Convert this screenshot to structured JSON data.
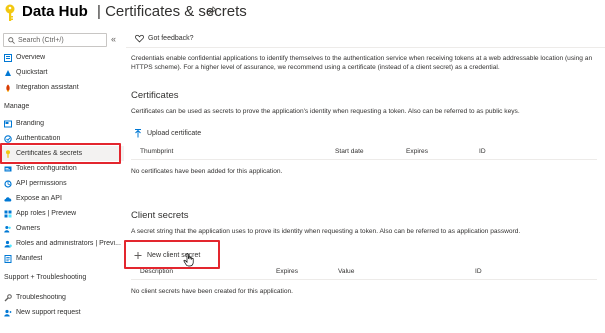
{
  "header": {
    "app_name": "Data Hub",
    "page_title": "| Certificates & secrets"
  },
  "sidebar": {
    "search_placeholder": "Search (Ctrl+/)",
    "collapse_glyph": "«",
    "items_top": [
      {
        "label": "Overview",
        "icon": "overview-icon"
      },
      {
        "label": "Quickstart",
        "icon": "quickstart-icon"
      },
      {
        "label": "Integration assistant",
        "icon": "rocket-icon"
      }
    ],
    "manage_heading": "Manage",
    "manage_items": [
      {
        "label": "Branding",
        "icon": "branding-icon"
      },
      {
        "label": "Authentication",
        "icon": "authentication-icon"
      },
      {
        "label": "Certificates & secrets",
        "icon": "key-icon",
        "active": true
      },
      {
        "label": "Token configuration",
        "icon": "token-icon"
      },
      {
        "label": "API permissions",
        "icon": "permissions-icon"
      },
      {
        "label": "Expose an API",
        "icon": "cloud-icon"
      },
      {
        "label": "App roles | Preview",
        "icon": "app-roles-icon"
      },
      {
        "label": "Owners",
        "icon": "owners-icon"
      },
      {
        "label": "Roles and administrators | Previ...",
        "icon": "roles-icon"
      },
      {
        "label": "Manifest",
        "icon": "manifest-icon"
      }
    ],
    "support_heading": "Support + Troubleshooting",
    "support_items": [
      {
        "label": "Troubleshooting",
        "icon": "wrench-icon"
      },
      {
        "label": "New support request",
        "icon": "support-icon"
      }
    ]
  },
  "main": {
    "feedback_label": "Got feedback?",
    "intro": "Credentials enable confidential applications to identify themselves to the authentication service when receiving tokens at a web addressable location (using an HTTPS scheme). For a higher level of assurance, we recommend using a certificate (instead of a client secret) as a credential.",
    "certificates": {
      "title": "Certificates",
      "description": "Certificates can be used as secrets to prove the application's identity when requesting a token. Also can be referred to as public keys.",
      "upload_label": "Upload certificate",
      "columns": [
        "Thumbprint",
        "Start date",
        "Expires",
        "ID"
      ],
      "empty": "No certificates have been added for this application."
    },
    "client_secrets": {
      "title": "Client secrets",
      "description": "A secret string that the application uses to prove its identity when requesting a token. Also can be referred to as application password.",
      "new_label": "New client secret",
      "columns": [
        "Description",
        "Expires",
        "Value",
        "ID"
      ],
      "empty": "No client secrets have been created for this application."
    }
  },
  "colors": {
    "accent": "#0078d4",
    "highlight": "#e3262e",
    "key_yellow": "#f2c811"
  }
}
